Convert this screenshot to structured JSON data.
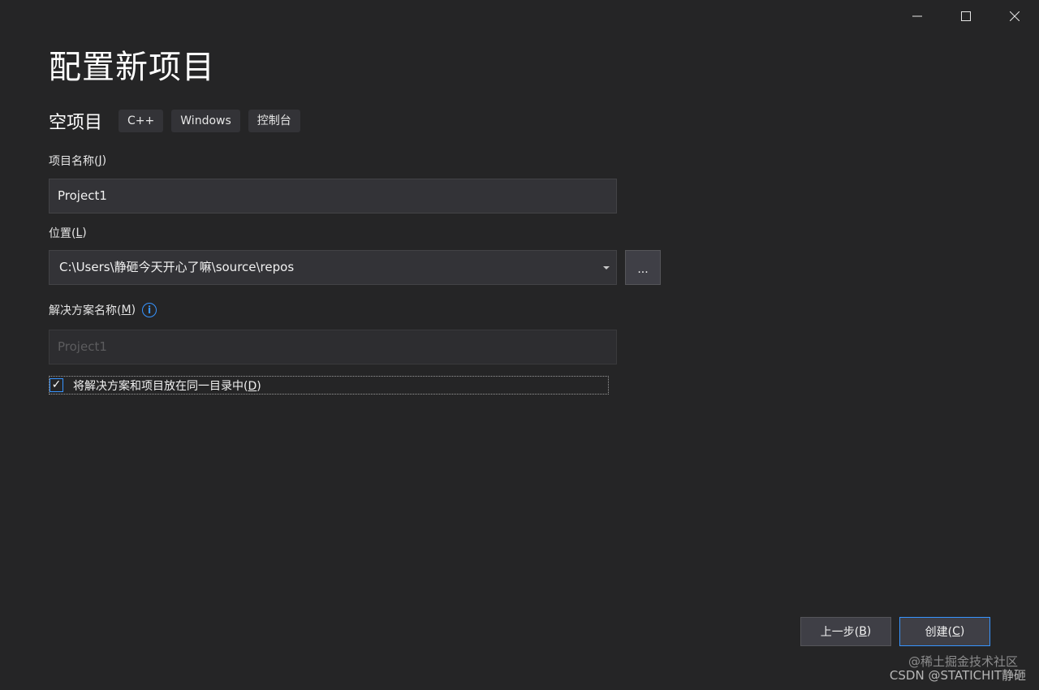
{
  "window": {
    "minimize_icon": "minimize-icon",
    "maximize_icon": "maximize-icon",
    "close_icon": "close-icon"
  },
  "page": {
    "title": "配置新项目"
  },
  "template": {
    "name": "空项目",
    "tags": [
      "C++",
      "Windows",
      "控制台"
    ]
  },
  "project_name": {
    "label_text": "项目名称(",
    "label_accel": "J",
    "label_end": ")",
    "value": "Project1"
  },
  "location": {
    "label_text": "位置(",
    "label_accel": "L",
    "label_end": ")",
    "value": "C:\\Users\\静砸今天开心了嘛\\source\\repos",
    "browse_label": "..."
  },
  "solution_name": {
    "label_text": "解决方案名称(",
    "label_accel": "M",
    "label_end": ")",
    "info_glyph": "i",
    "value": "Project1"
  },
  "same_directory": {
    "checked": true,
    "check_glyph": "✓",
    "label_text": "将解决方案和项目放在同一目录中(",
    "label_accel": "D",
    "label_end": ")"
  },
  "footer": {
    "back_text": "上一步(",
    "back_accel": "B",
    "back_end": ")",
    "create_text": "创建(",
    "create_accel": "C",
    "create_end": ")"
  },
  "watermark": {
    "line1": "@稀土掘金技术社区",
    "line2": "CSDN @STATICHIT静砸"
  },
  "colors": {
    "background": "#252526",
    "input_background": "#333337",
    "accent": "#3794ff"
  }
}
